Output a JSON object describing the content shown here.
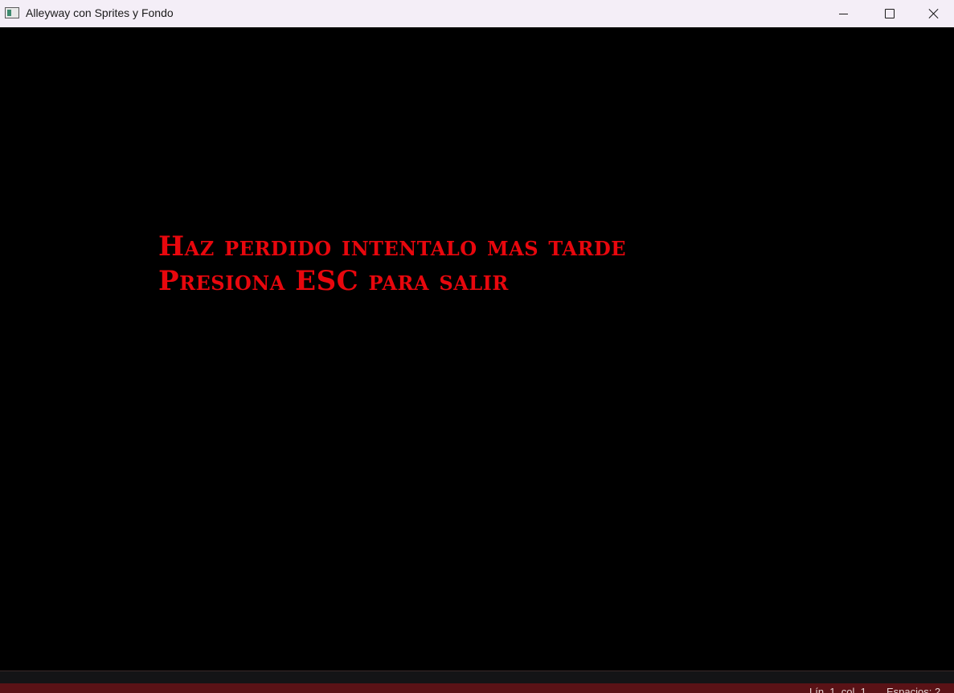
{
  "window": {
    "title": "Alleyway con Sprites y Fondo",
    "icon": "app-window-icon",
    "controls": {
      "minimize_icon": "minimize-icon",
      "maximize_icon": "maximize-icon",
      "close_icon": "close-icon"
    }
  },
  "game": {
    "background_color": "#000000",
    "text_color": "#e8070d",
    "message_line1": "Haz perdido intentalo mas tarde",
    "message_line2": "Presiona ESC para salir"
  },
  "statusbar": {
    "position": "Lín. 1, col. 1",
    "spaces": "Espacios: 2",
    "background_color": "#5a1216"
  }
}
